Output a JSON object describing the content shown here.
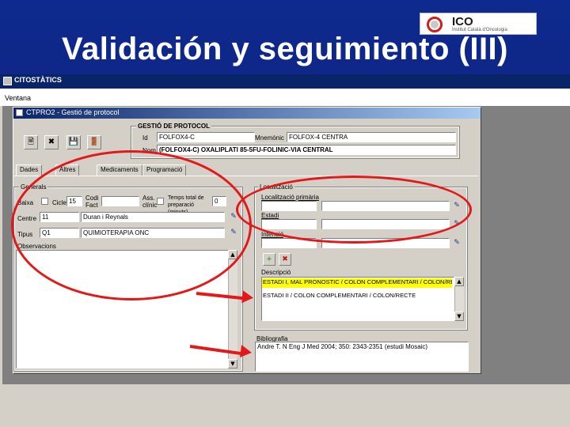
{
  "slide": {
    "title": "Validación y seguimiento (III)",
    "logo": {
      "text": "ICO",
      "subtitle": "Institut Català d'Oncologia"
    }
  },
  "app": {
    "title": "CITOSTÀTICS",
    "menu": [
      "Ventana"
    ],
    "window_title": "CTPRO2 - Gestió de protocol"
  },
  "protocol": {
    "group_label": "GESTIÓ DE PROTOCOL",
    "id_label": "Id",
    "id_value": "FOLFOX4-C",
    "mnemonic_label": "Mnemònic",
    "mnemonic_value": "FOLFOX-4 CENTRA",
    "name_label": "Nom",
    "name_value": "(FOLFOX4-C) OXALIPLATI 85-5FU-FOLINIC-VIA CENTRAL",
    "toolbar_icons": [
      "new-document-icon",
      "delete-document-icon",
      "save-icon",
      "exit-icon"
    ]
  },
  "tabs": [
    "Dades",
    "Altres",
    "Medicaments",
    "Programació"
  ],
  "generals": {
    "group_label": "Generals",
    "baixa_label": "Baixa",
    "cicle_label": "Cicle",
    "cicle_value": "15",
    "codi_fact_label": "Codi Fact",
    "ass_clinic_label": "Ass. clínic",
    "temps_label": "Temps total de preparació (minuts)",
    "temps_value": "0",
    "centre_label": "Centre",
    "centre_code": "11",
    "centre_name": "Duran i Reynals",
    "tipus_label": "Tipus",
    "tipus_code": "Q1",
    "tipus_name": "QUIMIOTERAPIA ONC",
    "observacions_label": "Observacions"
  },
  "localitzacio": {
    "group_label": "Localització",
    "primaria_label": "Localització primària",
    "estadi_label": "Estadi",
    "intencio_label": "Intenció",
    "descripcio_label": "Descripció",
    "descripcio_items": [
      {
        "text": "ESTADI I, MAL PRONOSTIC / COLON COMPLEMENTARI / COLON/RECTE",
        "selected": true
      },
      {
        "text": "ESTADI II / COLON COMPLEMENTARI / COLON/RECTE",
        "selected": false
      }
    ],
    "bibliografia_label": "Bibliografia",
    "bibliografia_value": "Andre T. N Eng J Med 2004; 350: 2343-2351 (estudi Mosaic)"
  },
  "annotation_color": "#e41818"
}
